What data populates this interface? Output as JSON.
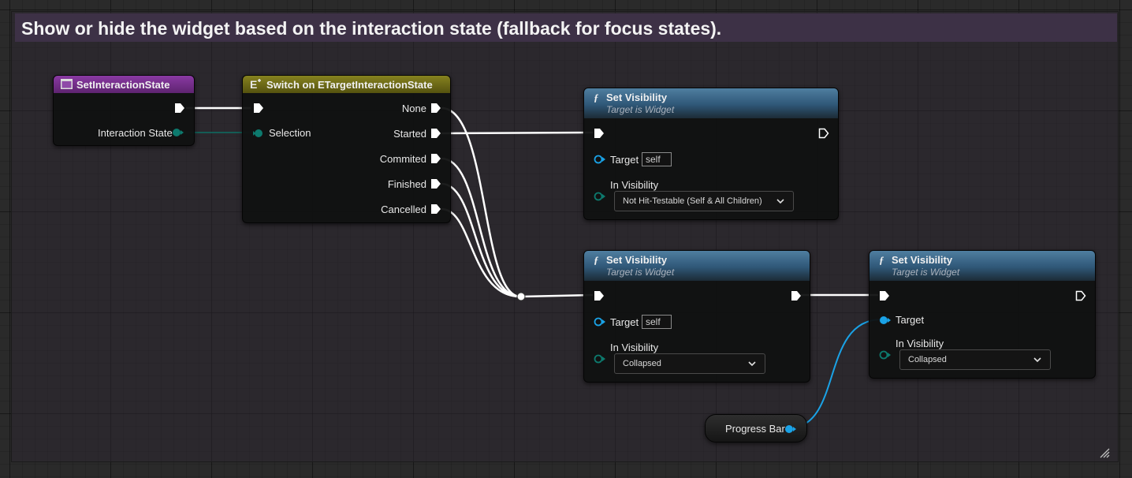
{
  "comment": {
    "title": "Show or hide the widget based on the interaction state (fallback for focus states)."
  },
  "event_node": {
    "title": "SetInteractionState",
    "icon": "event-function-icon",
    "header_color": "#6a2b7e",
    "output_param": "Interaction State"
  },
  "switch_node": {
    "title": "Switch on ETargetInteractionState",
    "icon": "switch-enum-icon",
    "header_color": "#6d6a1c",
    "input_param": "Selection",
    "outputs": [
      "None",
      "Started",
      "Commited",
      "Finished",
      "Cancelled"
    ]
  },
  "set_vis_1": {
    "title": "Set Visibility",
    "subtitle": "Target is Widget",
    "target_label": "Target",
    "target_value": "self",
    "vis_label": "In Visibility",
    "vis_value": "Not Hit-Testable (Self & All Children)"
  },
  "set_vis_2": {
    "title": "Set Visibility",
    "subtitle": "Target is Widget",
    "target_label": "Target",
    "target_value": "self",
    "vis_label": "In Visibility",
    "vis_value": "Collapsed"
  },
  "set_vis_3": {
    "title": "Set Visibility",
    "subtitle": "Target is Widget",
    "target_label": "Target",
    "vis_label": "In Visibility",
    "vis_value": "Collapsed"
  },
  "progress_bar_node": {
    "label": "Progress Bar"
  },
  "colors": {
    "exec_wire": "#ffffff",
    "enum_pin": "#0d7a6e",
    "object_pin": "#1aa2e6",
    "function_header": "#3f6f93"
  }
}
